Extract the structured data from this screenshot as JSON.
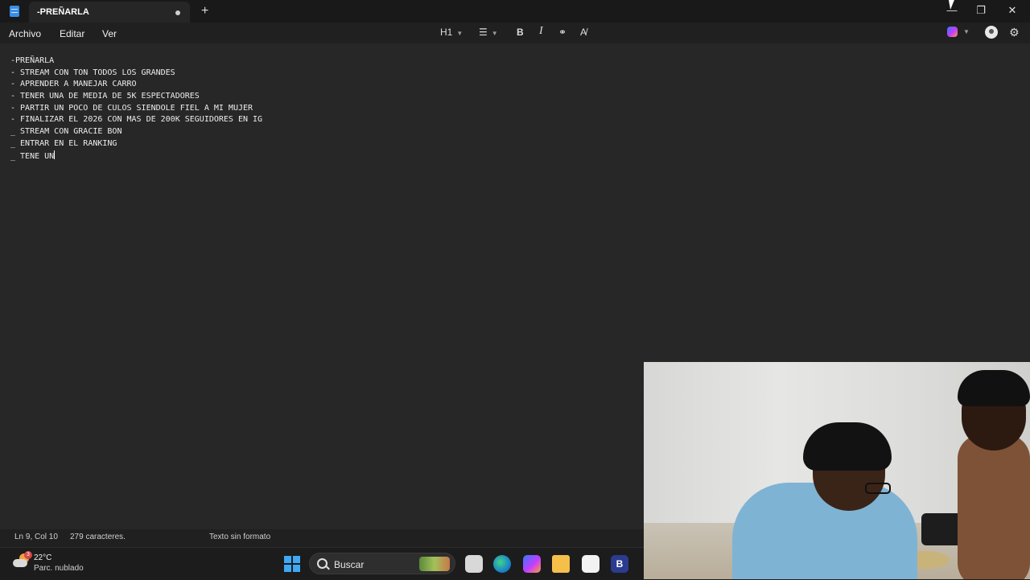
{
  "app": {
    "tab_title": "-PREÑARLA"
  },
  "menu": {
    "items": [
      "Archivo",
      "Editar",
      "Ver"
    ]
  },
  "toolbar": {
    "heading_label": "H1"
  },
  "document": {
    "lines": [
      "-PREÑARLA",
      "- STREAM CON TON TODOS LOS GRANDES",
      "- APRENDER A MANEJAR CARRO",
      "- TENER UNA DE MEDIA DE 5K ESPECTADORES",
      "- PARTIR UN POCO DE CULOS SIENDOLE FIEL A MI MUJER",
      "- FINALIZAR EL 2026 CON MAS DE 200K SEGUIDORES EN IG",
      "_ STREAM CON GRACIE BON",
      "_ ENTRAR EN EL RANKING",
      "_ TENE UN"
    ]
  },
  "status": {
    "position": "Ln 9, Col 10",
    "char_count": "279 caracteres.",
    "format": "Texto sin formato"
  },
  "taskbar": {
    "weather_temp": "22°C",
    "weather_desc": "Parc. nublado",
    "weather_badge": "3",
    "search_placeholder": "Buscar",
    "pinned_letter": "B"
  },
  "colors": {
    "background": "#272727",
    "titlebar": "#191919",
    "text": "#ececec",
    "accent": "#3fa8f5"
  }
}
